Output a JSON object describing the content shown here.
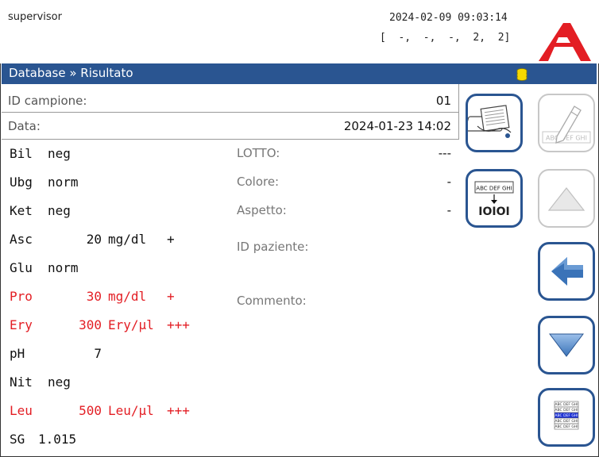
{
  "header": {
    "user": "supervisor",
    "datetime": "2024-02-09 09:03:14",
    "status": "[  -,  -,  -,  2,  2]"
  },
  "titlebar": {
    "title": "Database » Risultato"
  },
  "meta": {
    "sample_id_label": "ID campione:",
    "sample_id": "01",
    "date_label": "Data:",
    "date": "2024-01-23 14:02"
  },
  "results": [
    {
      "name": "Bil",
      "value": "neg",
      "unit": "",
      "flag": "",
      "abnormal": false
    },
    {
      "name": "Ubg",
      "value": "norm",
      "unit": "",
      "flag": "",
      "abnormal": false
    },
    {
      "name": "Ket",
      "value": "neg",
      "unit": "",
      "flag": "",
      "abnormal": false
    },
    {
      "name": "Asc",
      "value": "20",
      "unit": "mg/dl",
      "flag": "+",
      "abnormal": false
    },
    {
      "name": "Glu",
      "value": "norm",
      "unit": "",
      "flag": "",
      "abnormal": false
    },
    {
      "name": "Pro",
      "value": "30",
      "unit": "mg/dl",
      "flag": "+",
      "abnormal": true
    },
    {
      "name": "Ery",
      "value": "300",
      "unit": "Ery/µl",
      "flag": "+++",
      "abnormal": true
    },
    {
      "name": "pH",
      "value": "7",
      "unit": "",
      "flag": "",
      "abnormal": false
    },
    {
      "name": "Nit",
      "value": "neg",
      "unit": "",
      "flag": "",
      "abnormal": false
    },
    {
      "name": "Leu",
      "value": "500",
      "unit": "Leu/µl",
      "flag": "+++",
      "abnormal": true
    },
    {
      "name": "SG",
      "value": "1.015",
      "unit": "",
      "flag": "",
      "abnormal": false
    }
  ],
  "fields": {
    "lot_label": "LOTTO:",
    "lot_value": "---",
    "color_label": "Colore:",
    "color_value": "-",
    "appearance_label": "Aspetto:",
    "appearance_value": "-",
    "patient_label": "ID paziente:",
    "comment_label": "Commento:"
  },
  "buttons": {
    "ocr_label": "ABC DEF GHI",
    "ocr_digits": "IOIOI",
    "edit_label": "ABC DEF GHI"
  },
  "colors": {
    "accent": "#2a5591",
    "abnormal": "#e31e24",
    "logo": "#e31e24",
    "db_icon": "#f5d800"
  }
}
